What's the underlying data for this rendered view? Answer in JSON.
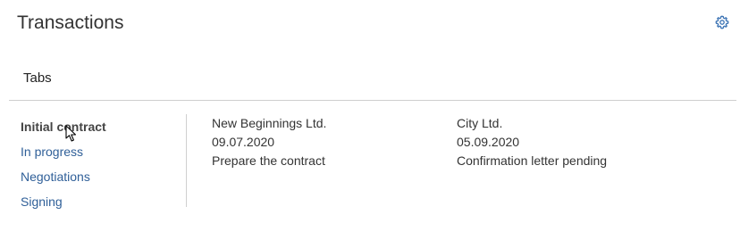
{
  "header": {
    "title": "Transactions",
    "settings_icon": "gear-icon"
  },
  "section": {
    "title": "Tabs"
  },
  "tabs": [
    {
      "label": "Initial contract",
      "active": true
    },
    {
      "label": "In progress",
      "active": false
    },
    {
      "label": "Negotiations",
      "active": false
    },
    {
      "label": "Signing",
      "active": false
    }
  ],
  "cards": [
    {
      "company": "New Beginnings Ltd.",
      "date": "09.07.2020",
      "status": "Prepare the contract"
    },
    {
      "company": "City Ltd.",
      "date": "05.09.2020",
      "status": "Confirmation letter pending"
    }
  ],
  "colors": {
    "link": "#2f5f98",
    "active_tab": "#444444",
    "divider": "#cfcfcf",
    "icon": "#3b73b4"
  }
}
